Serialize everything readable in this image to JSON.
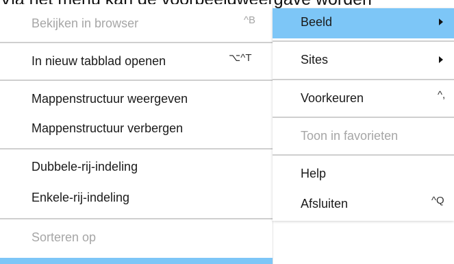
{
  "header": {
    "caption": "Via het menu kan de voorbeeldweergave worden"
  },
  "left_menu": {
    "items": [
      {
        "label": "Bekijken in browser",
        "shortcut": "^B"
      },
      {
        "label": "In nieuw tabblad openen",
        "shortcut": "⌥^T"
      },
      {
        "label": "Mappenstructuur weergeven"
      },
      {
        "label": "Mappenstructuur verbergen"
      },
      {
        "label": "Dubbele-rij-indeling"
      },
      {
        "label": "Enkele-rij-indeling"
      },
      {
        "label": "Sorteren op"
      }
    ]
  },
  "right_menu": {
    "items": [
      {
        "label": "Beeld"
      },
      {
        "label": "Sites"
      },
      {
        "label": "Voorkeuren",
        "shortcut": "^,"
      },
      {
        "label": "Toon in favorieten"
      },
      {
        "label": "Help"
      },
      {
        "label": "Afsluiten",
        "shortcut": "^Q"
      }
    ]
  },
  "colors": {
    "highlight": "#7dc6f7",
    "disabled_text": "#a6a6a6",
    "separator": "#cfcfcf"
  }
}
